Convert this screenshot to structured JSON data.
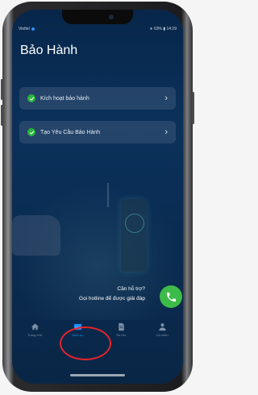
{
  "status_bar": {
    "left_text": "Viettel",
    "right_text": "∗ 63% ▮ 14:29"
  },
  "page_title": "Bảo Hành",
  "menu_items": [
    {
      "label": "Kích hoạt bảo hành",
      "chevron": "›"
    },
    {
      "label": "Tạo Yêu Cầu Bảo Hành",
      "chevron": "›"
    }
  ],
  "help": {
    "question": "Cần hỗ trợ?",
    "hotline_text": "Gọi hotline để được giải đáp"
  },
  "tabs": [
    {
      "label": "Trang chủ",
      "icon": "home-icon",
      "active": false
    },
    {
      "label": "Dịch vụ",
      "icon": "service-icon",
      "active": true
    },
    {
      "label": "Tin tức",
      "icon": "news-icon",
      "active": false
    },
    {
      "label": "Cá nhân",
      "icon": "person-icon",
      "active": false
    }
  ],
  "colors": {
    "background": "#0b315b",
    "accent": "#1e90ff",
    "check": "#27b53a",
    "call_button": "#3dbb48",
    "annotation": "#e5232a"
  }
}
